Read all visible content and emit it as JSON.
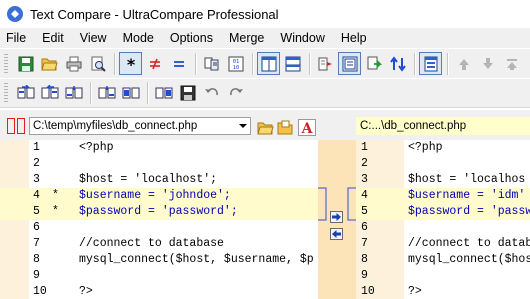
{
  "window": {
    "title": "Text Compare - UltraCompare Professional"
  },
  "menu": {
    "items": [
      "File",
      "Edit",
      "View",
      "Mode",
      "Options",
      "Merge",
      "Window",
      "Help"
    ]
  },
  "toolbar1": {
    "buttons": [
      "save-icon",
      "open-folder-icon",
      "print-icon",
      "print-preview-icon",
      "show-all-icon",
      "show-differences-icon",
      "show-matches-icon",
      "compare-icon",
      "binary-compare-icon",
      "two-pane-icon",
      "horizontal-split-icon",
      "merge-icon",
      "view-mode-icon",
      "sync-icon",
      "sort-icon",
      "single-pane-icon",
      "previous-difference-icon",
      "next-difference-icon",
      "first-difference-icon"
    ]
  },
  "toolbar2": {
    "buttons": [
      "copy-left-to-right-icon",
      "copy-right-to-left-icon",
      "copy-line-left-icon",
      "copy-line-right-icon",
      "copy-block-left-icon",
      "copy-block-right-icon",
      "save-merged-icon",
      "undo-icon",
      "redo-icon"
    ]
  },
  "paths": {
    "left": "C:\\temp\\myfiles\\db_connect.php",
    "right": "C:...\\db_connect.php"
  },
  "left_pane": {
    "lines": [
      {
        "num": "1",
        "marker": "",
        "code": "<?php",
        "changed": false
      },
      {
        "num": "2",
        "marker": "",
        "code": "",
        "changed": false
      },
      {
        "num": "3",
        "marker": "",
        "code": "$host = 'localhost';",
        "changed": false
      },
      {
        "num": "4",
        "marker": "*",
        "code": "$username = 'johndoe';",
        "changed": true
      },
      {
        "num": "5",
        "marker": "*",
        "code": "$password = 'password';",
        "changed": true
      },
      {
        "num": "6",
        "marker": "",
        "code": "",
        "changed": false
      },
      {
        "num": "7",
        "marker": "",
        "code": "//connect to database",
        "changed": false
      },
      {
        "num": "8",
        "marker": "",
        "code": "mysql_connect($host, $username, $p",
        "changed": false
      },
      {
        "num": "9",
        "marker": "",
        "code": "",
        "changed": false
      },
      {
        "num": "10",
        "marker": "",
        "code": "?>",
        "changed": false
      }
    ]
  },
  "right_pane": {
    "lines": [
      {
        "num": "1",
        "code": "<?php",
        "changed": false
      },
      {
        "num": "2",
        "code": "",
        "changed": false
      },
      {
        "num": "3",
        "code": "$host = 'localhos",
        "changed": false
      },
      {
        "num": "4",
        "code": "$username = 'idm'",
        "changed": true
      },
      {
        "num": "5",
        "code": "$password = 'passw",
        "changed": true
      },
      {
        "num": "6",
        "code": "",
        "changed": false
      },
      {
        "num": "7",
        "code": "//connect to datab",
        "changed": false
      },
      {
        "num": "8",
        "code": "mysql_connect($hos",
        "changed": false
      },
      {
        "num": "9",
        "code": "",
        "changed": false
      },
      {
        "num": "10",
        "code": "?>",
        "changed": false
      }
    ]
  },
  "colors": {
    "gutter": "#fdf1db",
    "changed_line": "#fffbcc",
    "middle_strip": "#fce4b8",
    "difference_border": "#3050d0",
    "line_number": "#0000a0"
  }
}
